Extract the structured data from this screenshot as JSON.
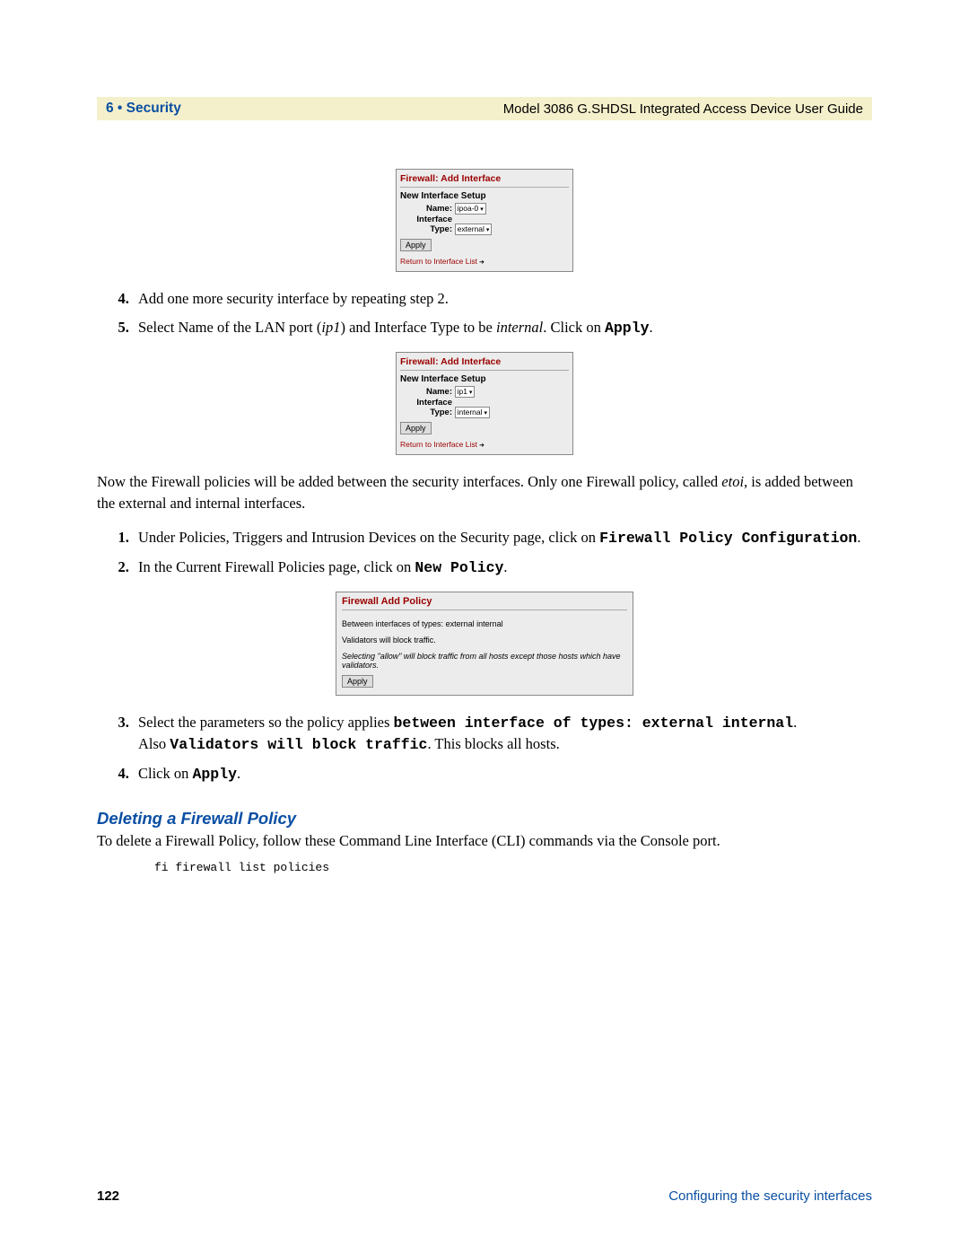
{
  "header": {
    "left": "6 • Security",
    "right": "Model 3086 G.SHDSL Integrated Access Device User Guide"
  },
  "dialog1": {
    "title": "Firewall: Add Interface",
    "setup": "New Interface Setup",
    "name_label": "Name:",
    "name_value": "ipoa-0",
    "type_label": "Interface Type:",
    "type_value": "external",
    "apply": "Apply",
    "return": "Return to Interface List"
  },
  "step4_text": "Add one more security interface by repeating step 2.",
  "step5_prefix": "Select Name of the LAN port (",
  "step5_ip1": "ip1",
  "step5_mid": ") and Interface Type to be ",
  "step5_internal": "internal",
  "step5_click": ". Click on ",
  "step5_apply": "Apply",
  "step5_end": ".",
  "dialog2": {
    "title": "Firewall: Add Interface",
    "setup": "New Interface Setup",
    "name_label": "Name:",
    "name_value": "ip1",
    "type_label": "Interface Type:",
    "type_value": "internal",
    "apply": "Apply",
    "return": "Return to Interface List"
  },
  "para_b_1": "Now the Firewall policies will be added between the security interfaces.  Only one Firewall policy, called ",
  "para_b_etoi": "etoi",
  "para_b_2": ", is added between the external and internal interfaces.",
  "b1_prefix": "Under Policies, Triggers and Intrusion Devices on the Security page, click on ",
  "b1_mono": "Firewall Policy Configuration",
  "b1_suffix": ".",
  "b2_prefix": "In the Current Firewall Policies page, click on ",
  "b2_mono": "New Policy",
  "b2_suffix": ".",
  "policy_dialog": {
    "title": "Firewall Add Policy",
    "between_label": "Between interfaces of types:",
    "between_val1": "external",
    "between_val2": "internal",
    "validators_pre": "Validators will",
    "validators_sel": "block",
    "validators_post": "traffic.",
    "note": "Selecting \"allow\" will block traffic from all hosts except those hosts which have validators.",
    "apply": "Apply"
  },
  "b3_prefix": "Select the parameters so the policy applies ",
  "b3_mono": "between interface of types: external internal",
  "b3_suffix": ".",
  "b3_also_pre": "Also ",
  "b3_also_mono": "Validators will block traffic",
  "b3_also_suf": ". This blocks all hosts.",
  "b4_prefix": "Click on ",
  "b4_mono": "Apply",
  "b4_suffix": ".",
  "section_heading": "Deleting a Firewall Policy",
  "delete_para": "To delete a Firewall Policy, follow these Command Line Interface (CLI) commands via the Console port.",
  "cli_cmd": "fi  firewall list policies",
  "footer": {
    "page": "122",
    "label": "Configuring the security interfaces"
  }
}
